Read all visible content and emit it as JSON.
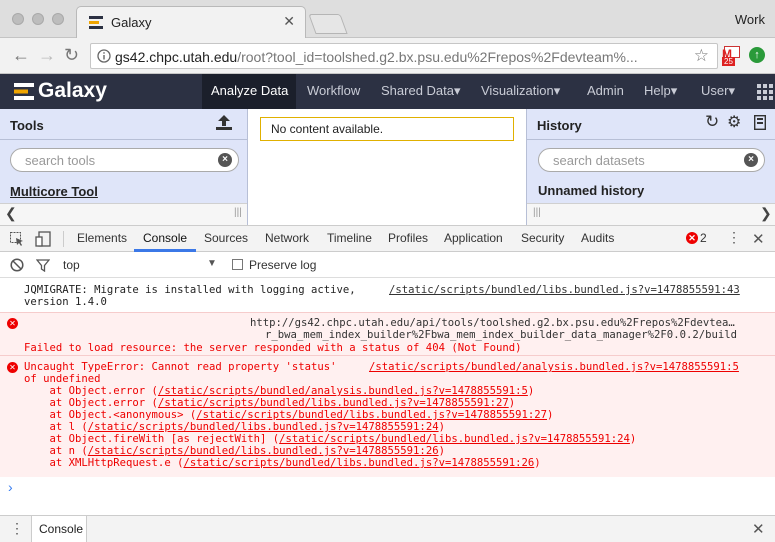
{
  "browser": {
    "tab_title": "Galaxy",
    "tab_close": "✕",
    "profile": "Work",
    "url_host": "gs42.chpc.utah.edu",
    "url_path": "/root?tool_id=toolshed.g2.bx.psu.edu%2Frepos%2Fdevteam%...",
    "badge_text": "25"
  },
  "masthead": {
    "brand": "Galaxy",
    "nav": [
      "Analyze Data",
      "Workflow",
      "Shared Data",
      "Visualization",
      "Admin",
      "Help",
      "User"
    ],
    "caret": "▾"
  },
  "tools": {
    "title": "Tools",
    "search_placeholder": "search tools",
    "first_section": "Multicore Tool"
  },
  "center": {
    "message": "No content available."
  },
  "history": {
    "title": "History",
    "search_placeholder": "search datasets",
    "name": "Unnamed history"
  },
  "devtools": {
    "tabs": [
      "Elements",
      "Console",
      "Sources",
      "Network",
      "Timeline",
      "Profiles",
      "Application",
      "Security",
      "Audits"
    ],
    "active_tab": "Console",
    "error_count": "2",
    "context": "top",
    "preserve_log": "Preserve log",
    "logs": {
      "jqmigrate_text": "JQMIGRATE: Migrate is installed with logging active,\nversion 1.4.0",
      "jqmigrate_src": "/static/scripts/bundled/libs.bundled.js?v=1478855591:43",
      "err1_url1": "http://gs42.chpc.utah.edu/api/tools/toolshed.g2.bx.psu.edu%2Frepos%2Fdevtea…",
      "err1_url2": "r_bwa_mem_index_builder%2Fbwa_mem_index_builder_data_manager%2F0.0.2/build",
      "err1_msg": "Failed to load resource: the server responded with a status of 404 (Not Found)",
      "err2_msg": "Uncaught TypeError: Cannot read property 'status'\nof undefined",
      "err2_src": "/static/scripts/bundled/analysis.bundled.js?v=1478855591:5",
      "stack": [
        {
          "fn": "    at Object.error (",
          "src": "/static/scripts/bundled/analysis.bundled.js?v=1478855591:5",
          "end": ")"
        },
        {
          "fn": "    at Object.error (",
          "src": "/static/scripts/bundled/libs.bundled.js?v=1478855591:27",
          "end": ")"
        },
        {
          "fn": "    at Object.<anonymous> (",
          "src": "/static/scripts/bundled/libs.bundled.js?v=1478855591:27",
          "end": ")"
        },
        {
          "fn": "    at l (",
          "src": "/static/scripts/bundled/libs.bundled.js?v=1478855591:24",
          "end": ")"
        },
        {
          "fn": "    at Object.fireWith [as rejectWith] (",
          "src": "/static/scripts/bundled/libs.bundled.js?v=1478855591:24",
          "end": ")"
        },
        {
          "fn": "    at n (",
          "src": "/static/scripts/bundled/libs.bundled.js?v=1478855591:26",
          "end": ")"
        },
        {
          "fn": "    at XMLHttpRequest.e (",
          "src": "/static/scripts/bundled/libs.bundled.js?v=1478855591:26",
          "end": ")"
        }
      ],
      "prompt": "›"
    },
    "drawer_tab": "Console"
  },
  "colors": {
    "masthead_bg": "#2c3143",
    "panel_bg": "#dfe5f9",
    "error_red": "#e00000",
    "error_bg": "#fff0f0"
  }
}
